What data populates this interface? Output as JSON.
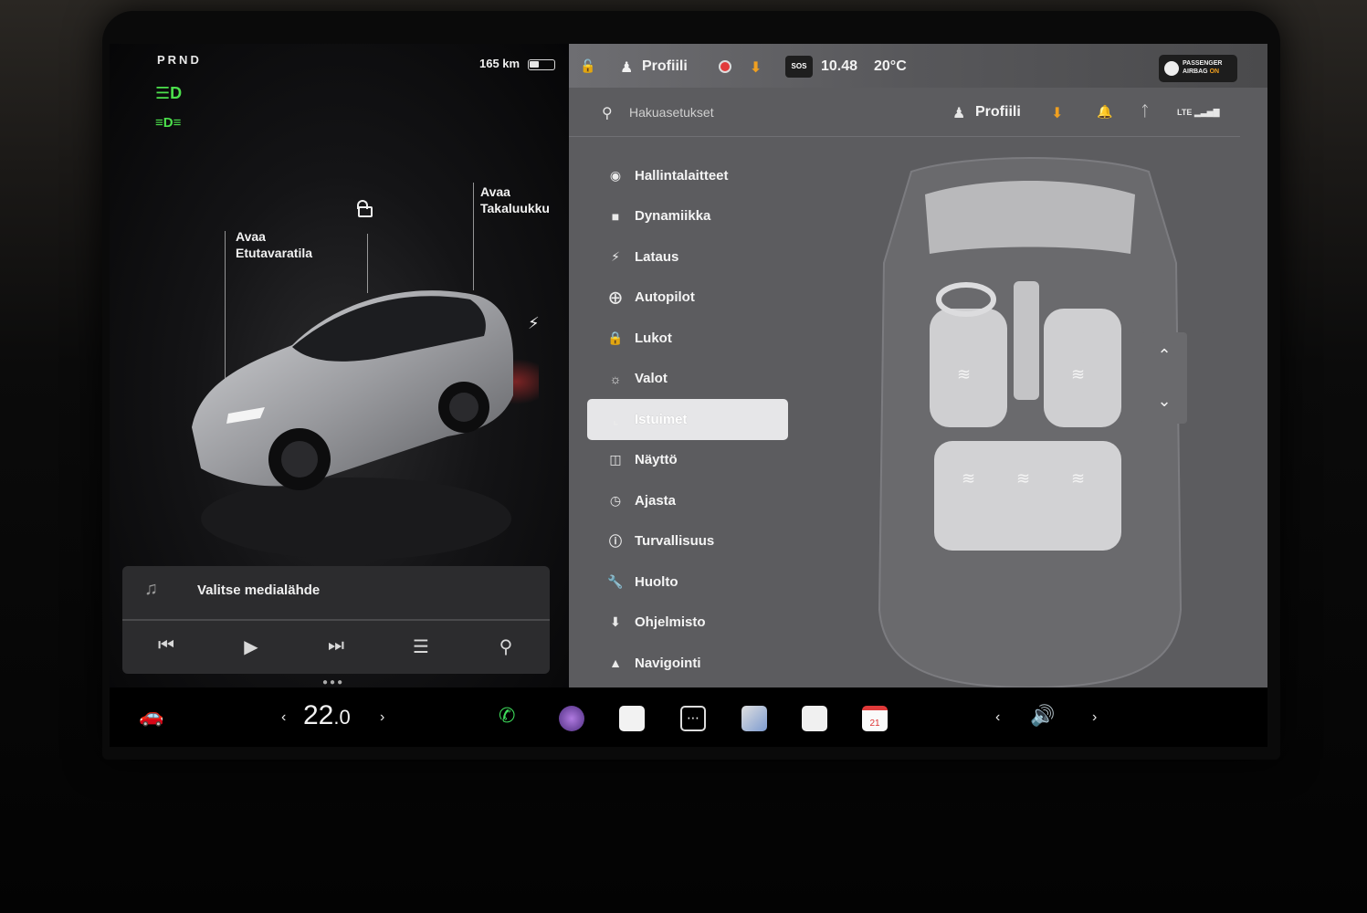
{
  "left_panel": {
    "gear": "PRND",
    "range": "165 km",
    "callouts": {
      "frunk_line1": "Avaa",
      "frunk_line2": "Etutavaratila",
      "trunk_line1": "Avaa",
      "trunk_line2": "Takaluukku"
    },
    "icons": [
      "headlights-icon",
      "fog-lights-icon",
      "unlock-icon",
      "charge-bolt-icon"
    ],
    "light_colors": {
      "lights_on": "#4ce04c"
    }
  },
  "media": {
    "title": "Valitse medialähde",
    "controls": [
      "previous-track",
      "play",
      "next-track",
      "equalizer",
      "search"
    ]
  },
  "topbar": {
    "profile": "Profiili",
    "time": "10.48",
    "temperature": "20°C",
    "sos": "SOS",
    "airbag_line1": "PASSENGER",
    "airbag_line2_a": "AIRBAG",
    "airbag_line2_b": "ON"
  },
  "settings": {
    "search_placeholder": "Hakuasetukset",
    "profile": "Profiili",
    "signal": "LTE",
    "menu": [
      {
        "label": "Hallintalaitteet",
        "icon": "toggle-icon"
      },
      {
        "label": "Dynamiikka",
        "icon": "car-icon"
      },
      {
        "label": "Lataus",
        "icon": "bolt-icon"
      },
      {
        "label": "Autopilot",
        "icon": "steering-wheel-icon"
      },
      {
        "label": "Lukot",
        "icon": "lock-icon"
      },
      {
        "label": "Valot",
        "icon": "sun-icon"
      },
      {
        "label": "Istuimet",
        "icon": "seat-icon",
        "active": true
      },
      {
        "label": "Näyttö",
        "icon": "display-icon"
      },
      {
        "label": "Ajasta",
        "icon": "clock-icon"
      },
      {
        "label": "Turvallisuus",
        "icon": "info-icon"
      },
      {
        "label": "Huolto",
        "icon": "wrench-icon"
      },
      {
        "label": "Ohjelmisto",
        "icon": "download-icon"
      },
      {
        "label": "Navigointi",
        "icon": "navigation-icon"
      }
    ]
  },
  "dock": {
    "temperature_whole": "22",
    "temperature_decimal": ".0",
    "calendar_day": "21"
  },
  "colors": {
    "download_accent": "#f0a020",
    "record_red": "#e23b3b",
    "phone_green": "#3ddc5a"
  }
}
